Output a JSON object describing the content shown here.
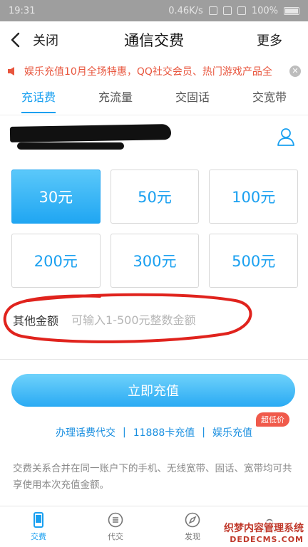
{
  "statusbar": {
    "time": "19:31",
    "speed": "0.46K/s",
    "battery": "100%"
  },
  "nav": {
    "back_label": "关闭",
    "title": "通信交费",
    "more_label": "更多"
  },
  "notice": {
    "text": "娱乐充值10月全场特惠，QQ社交会员、热门游戏产品全"
  },
  "tabs": [
    {
      "label": "充话费"
    },
    {
      "label": "充流量"
    },
    {
      "label": "交固话"
    },
    {
      "label": "交宽带"
    }
  ],
  "amounts": [
    {
      "label": "30元"
    },
    {
      "label": "50元"
    },
    {
      "label": "100元"
    },
    {
      "label": "200元"
    },
    {
      "label": "300元"
    },
    {
      "label": "500元"
    }
  ],
  "other_amount": {
    "label": "其他金额",
    "placeholder": "可输入1-500元整数金额"
  },
  "pay_button": {
    "label": "立即充值"
  },
  "links": {
    "item1": "办理话费代交",
    "item2": "11888卡充值",
    "item3": "娱乐充值",
    "badge": "超低价",
    "sep": "|"
  },
  "description": "交费关系合并在同一账户下的手机、无线宽带、固话、宽带均可共享使用本次充值金额。",
  "bottom_nav": [
    {
      "label": "交费"
    },
    {
      "label": "代交"
    },
    {
      "label": "发现"
    },
    {
      "label": ""
    }
  ],
  "watermark": {
    "line1": "织梦内容管理系统",
    "line2": "DEDECMS.COM"
  },
  "colors": {
    "accent": "#1aa0f0",
    "notice": "#e8553d",
    "badge": "#f05a4b"
  }
}
